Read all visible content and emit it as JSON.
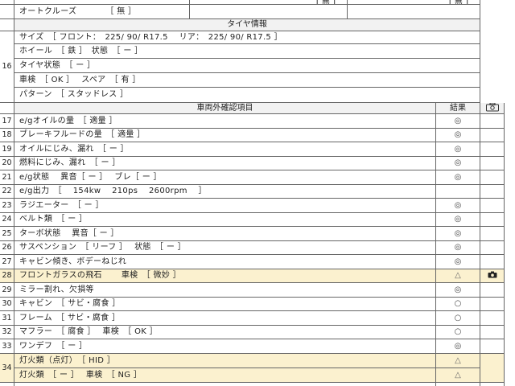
{
  "top_rows": [
    {
      "text": "",
      "right1": "[ 無 ]",
      "right2": "[ 無 ]"
    },
    {
      "text": "オートクルーズ　　　　［ 無 ］",
      "right1": "",
      "right2": ""
    }
  ],
  "tire": {
    "header": "タイヤ情報",
    "num": "16",
    "rows": [
      "サイズ　［ フロント：　225/ 90/ R17.5　 リア：　225/ 90/ R17.5 ］",
      "ホイール　［ 鉄 ］　状態　［ ー ］",
      "タイヤ状態　［ ー ］",
      "車検　［ OK ］　 スペア　［ 有 ］",
      "パターン　［ スタッドレス ］"
    ]
  },
  "check": {
    "header": "車両外確認項目",
    "result_header": "結果",
    "camera_icon": "camera-icon",
    "rows": [
      {
        "num": "17",
        "text": "e/gオイルの量　［ 適量 ］",
        "mark": "◎",
        "warn": false
      },
      {
        "num": "18",
        "text": "ブレーキフルードの量　［ 適量 ］",
        "mark": "◎",
        "warn": false
      },
      {
        "num": "19",
        "text": "オイルにじみ、漏れ　［ ー ］",
        "mark": "◎",
        "warn": false
      },
      {
        "num": "20",
        "text": "燃料にじみ、漏れ　［ ー ］",
        "mark": "◎",
        "warn": false
      },
      {
        "num": "21",
        "text": "e/g状態　 異音［ ー ］　 ブレ［ ー ］",
        "mark": "◎",
        "warn": false
      },
      {
        "num": "22",
        "text": "e/g出力　［　 154kw　 210ps　 2600rpm　 ］",
        "mark": "",
        "warn": false
      },
      {
        "num": "23",
        "text": "ラジエーター　［ ー ］",
        "mark": "◎",
        "warn": false
      },
      {
        "num": "24",
        "text": "ベルト類　［ ー ］",
        "mark": "◎",
        "warn": false
      },
      {
        "num": "25",
        "text": "ターボ状態　 異音［ ー ］",
        "mark": "◎",
        "warn": false
      },
      {
        "num": "26",
        "text": "サスペンション　［ リーフ ］　 状態　［ ー ］",
        "mark": "◎",
        "warn": false
      },
      {
        "num": "27",
        "text": "キャビン傾き、ボデーねじれ",
        "mark": "◎",
        "warn": false
      },
      {
        "num": "28",
        "text": "フロントガラスの飛石　　 車検　［ 微妙 ］",
        "mark": "△",
        "warn": true,
        "photo": true
      },
      {
        "num": "29",
        "text": "ミラー割れ、欠損等",
        "mark": "◎",
        "warn": false
      },
      {
        "num": "30",
        "text": "キャビン　［ サビ・腐食 ］",
        "mark": "○",
        "warn": false
      },
      {
        "num": "31",
        "text": "フレーム　［ サビ・腐食 ］",
        "mark": "○",
        "warn": false
      },
      {
        "num": "32",
        "text": "マフラー　［ 腐食 ］　 車検　［ OK ］",
        "mark": "○",
        "warn": false
      },
      {
        "num": "33",
        "text": "ワンデフ　［ ー ］",
        "mark": "◎",
        "warn": false
      }
    ],
    "row34": {
      "num": "34",
      "lines": [
        {
          "text": "灯火類（点灯）　［ HID ］",
          "mark": "△"
        },
        {
          "text": "灯火類　［ ー ］　 車検　［ NG ］",
          "mark": "△"
        }
      ]
    }
  },
  "colors": {
    "grid": "#666666",
    "header_bg": "#f2f2f2",
    "highlight_bg": "#fbf1cf"
  }
}
